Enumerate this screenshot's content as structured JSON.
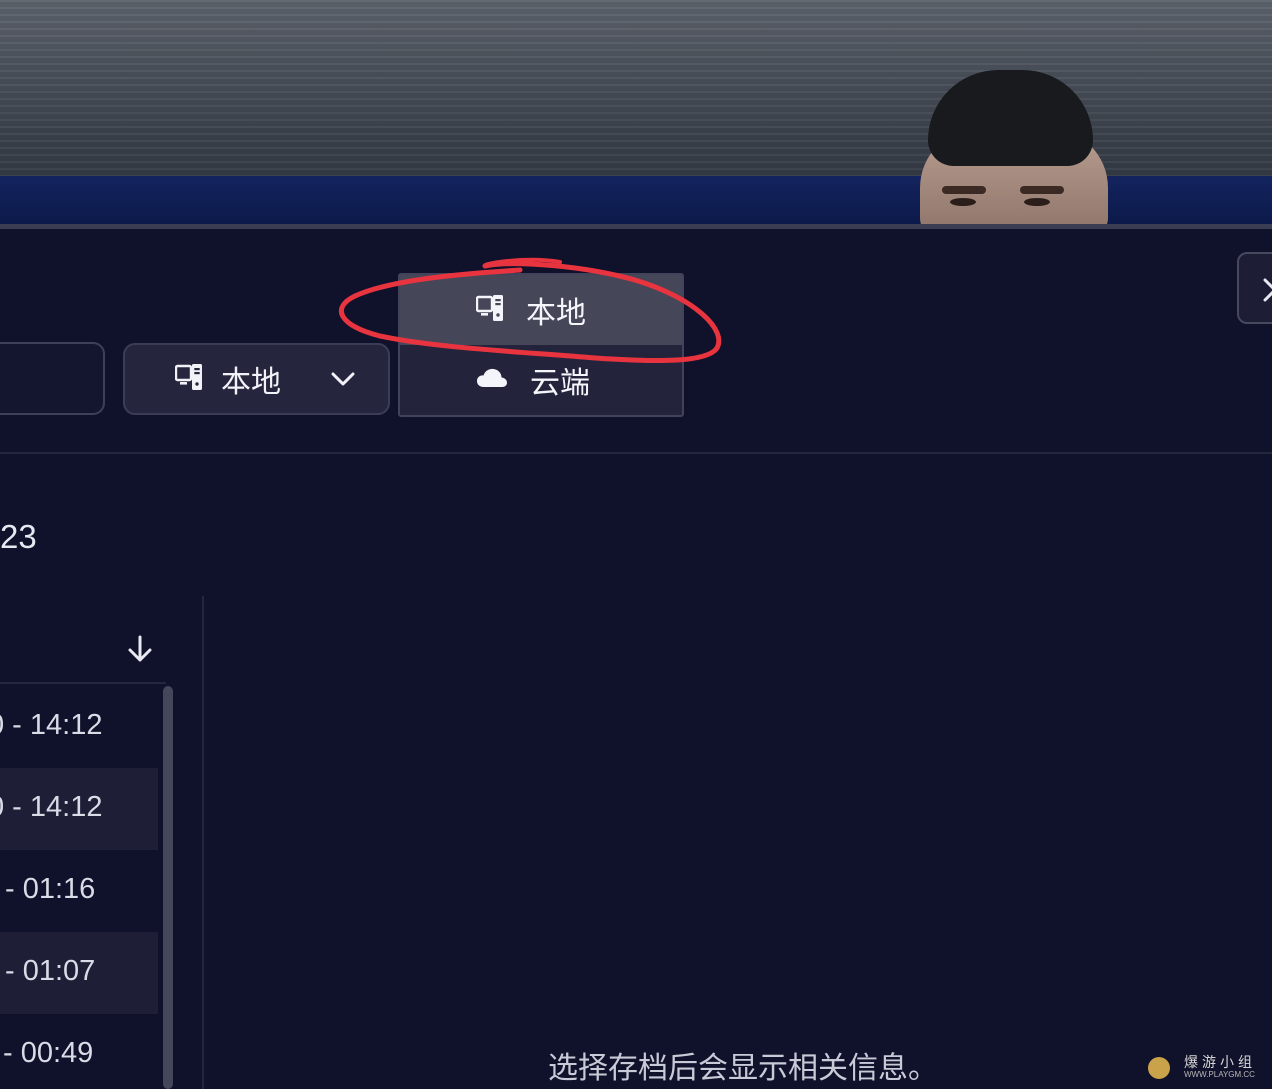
{
  "storage_selector": {
    "selected_label": "本地",
    "options": [
      {
        "label": "本地",
        "icon": "computer-icon",
        "selected": true
      },
      {
        "label": "云端",
        "icon": "cloud-icon",
        "selected": false
      }
    ]
  },
  "save_list": {
    "count_text": "23",
    "sort_icon": "arrow-down-icon",
    "rows": [
      {
        "text": "0 - 14:12"
      },
      {
        "text": "0 - 14:12"
      },
      {
        "text": "- 01:16"
      },
      {
        "text": "- 01:07"
      },
      {
        "text": "- 00:49"
      }
    ]
  },
  "detail": {
    "hint": "选择存档后会显示相关信息。"
  },
  "watermark": {
    "text": "爆游小组",
    "url": "WWW.PLAYGM.CC"
  },
  "colors": {
    "background": "#10112a",
    "control": "#25263d",
    "selected_option": "#454759",
    "annotation": "#e8343f"
  }
}
